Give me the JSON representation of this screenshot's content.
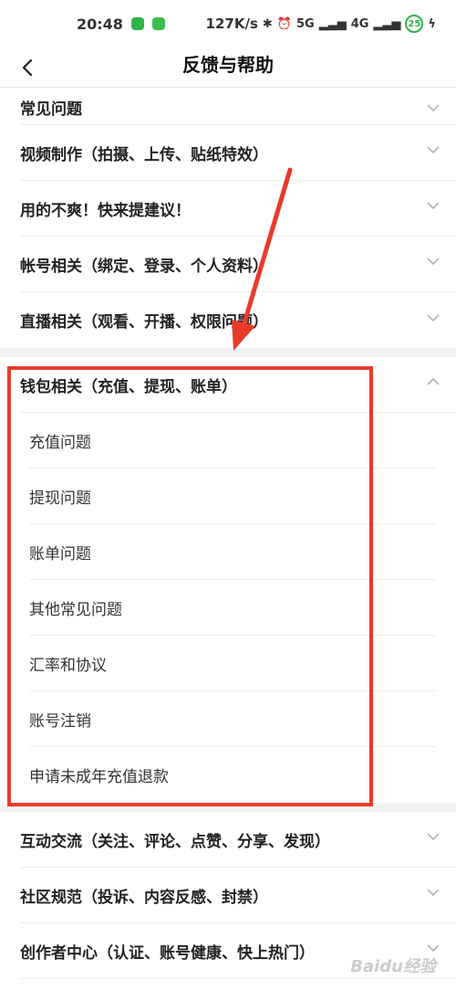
{
  "status_bar": {
    "time": "20:48",
    "network_speed": "127K/s",
    "battery": "25",
    "signal_text": "5G",
    "signal_text_2": "4G"
  },
  "header": {
    "title": "反馈与帮助",
    "back_icon": "chevron-left-icon"
  },
  "categories": [
    {
      "label": "常见问题",
      "expanded": false
    },
    {
      "label": "视频制作（拍摄、上传、贴纸特效）",
      "expanded": false
    },
    {
      "label": "用的不爽！快来提建议！",
      "expanded": false
    },
    {
      "label": "帐号相关（绑定、登录、个人资料）",
      "expanded": false
    },
    {
      "label": "直播相关（观看、开播、权限问题）",
      "expanded": false
    },
    {
      "label": "钱包相关（充值、提现、账单）",
      "expanded": true,
      "children": [
        "充值问题",
        "提现问题",
        "账单问题",
        "其他常见问题",
        "汇率和协议",
        "账号注销",
        "申请未成年充值退款"
      ]
    },
    {
      "label": "互动交流（关注、评论、点赞、分享、发现）",
      "expanded": false
    },
    {
      "label": "社区规范（投诉、内容反感、封禁）",
      "expanded": false
    },
    {
      "label": "创作者中心（认证、账号健康、快上热门）",
      "expanded": false
    }
  ],
  "colors": {
    "annotation_red": "#ea3a2a",
    "chevron": "#b3b3b3",
    "text_primary": "#222222",
    "divider": "#ededed"
  },
  "watermark": "Baidu经验"
}
